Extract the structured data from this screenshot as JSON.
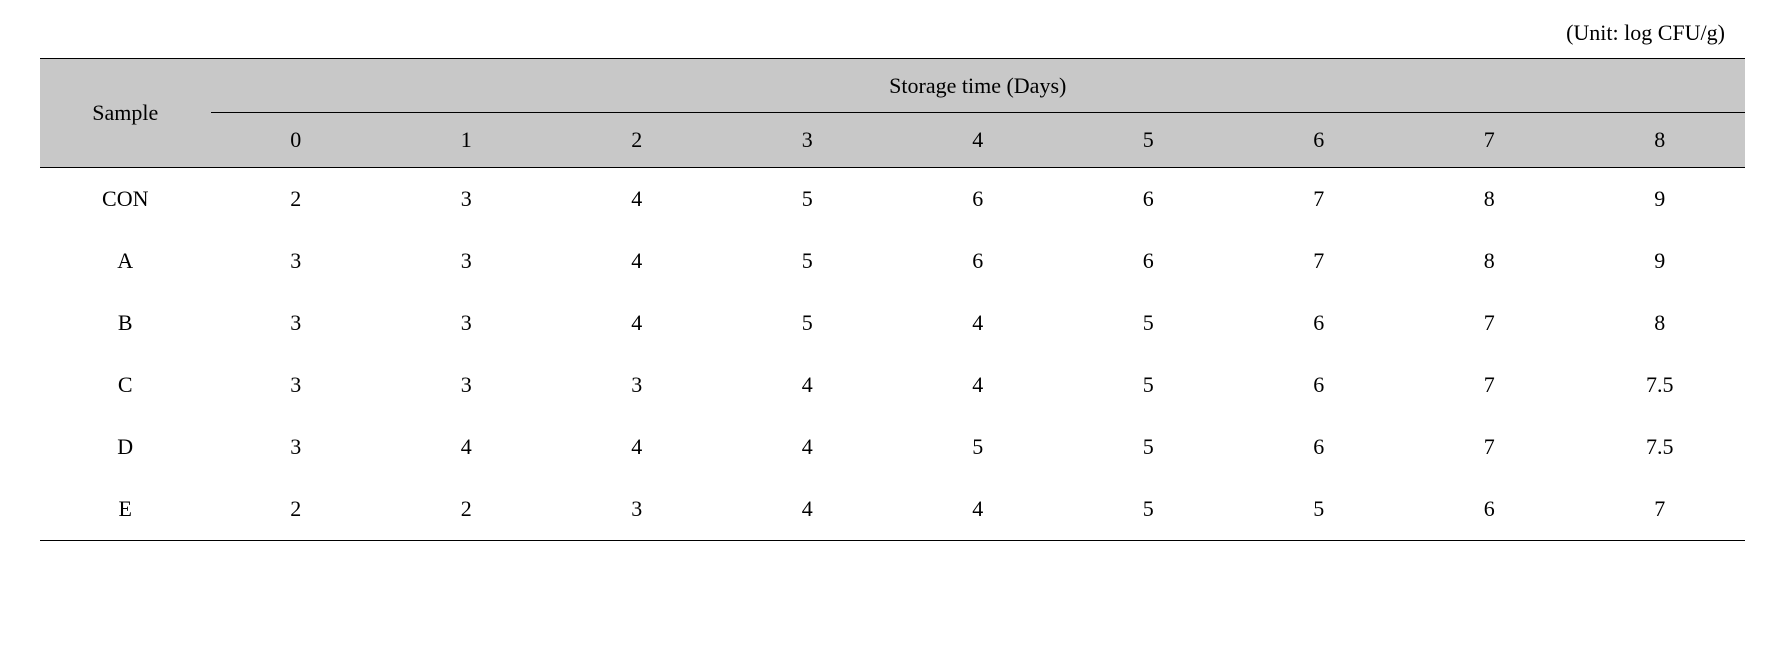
{
  "unit_label": "(Unit: log CFU/g)",
  "headers": {
    "sample": "Sample",
    "storage_time": "Storage time (Days)",
    "days": [
      "0",
      "1",
      "2",
      "3",
      "4",
      "5",
      "6",
      "7",
      "8"
    ]
  },
  "rows": [
    {
      "sample": "CON",
      "values": [
        "2",
        "3",
        "4",
        "5",
        "6",
        "6",
        "7",
        "8",
        "9"
      ]
    },
    {
      "sample": "A",
      "values": [
        "3",
        "3",
        "4",
        "5",
        "6",
        "6",
        "7",
        "8",
        "9"
      ]
    },
    {
      "sample": "B",
      "values": [
        "3",
        "3",
        "4",
        "5",
        "4",
        "5",
        "6",
        "7",
        "8"
      ]
    },
    {
      "sample": "C",
      "values": [
        "3",
        "3",
        "3",
        "4",
        "4",
        "5",
        "6",
        "7",
        "7.5"
      ]
    },
    {
      "sample": "D",
      "values": [
        "3",
        "4",
        "4",
        "4",
        "5",
        "5",
        "6",
        "7",
        "7.5"
      ]
    },
    {
      "sample": "E",
      "values": [
        "2",
        "2",
        "3",
        "4",
        "4",
        "5",
        "5",
        "6",
        "7"
      ]
    }
  ],
  "chart_data": {
    "type": "table",
    "title": "Storage time (Days)",
    "unit": "log CFU/g",
    "xlabel": "Storage time (Days)",
    "categories": [
      "0",
      "1",
      "2",
      "3",
      "4",
      "5",
      "6",
      "7",
      "8"
    ],
    "series": [
      {
        "name": "CON",
        "values": [
          2,
          3,
          4,
          5,
          6,
          6,
          7,
          8,
          9
        ]
      },
      {
        "name": "A",
        "values": [
          3,
          3,
          4,
          5,
          6,
          6,
          7,
          8,
          9
        ]
      },
      {
        "name": "B",
        "values": [
          3,
          3,
          4,
          5,
          4,
          5,
          6,
          7,
          8
        ]
      },
      {
        "name": "C",
        "values": [
          3,
          3,
          3,
          4,
          4,
          5,
          6,
          7,
          7.5
        ]
      },
      {
        "name": "D",
        "values": [
          3,
          4,
          4,
          4,
          5,
          5,
          6,
          7,
          7.5
        ]
      },
      {
        "name": "E",
        "values": [
          2,
          2,
          3,
          4,
          4,
          5,
          5,
          6,
          7
        ]
      }
    ]
  }
}
